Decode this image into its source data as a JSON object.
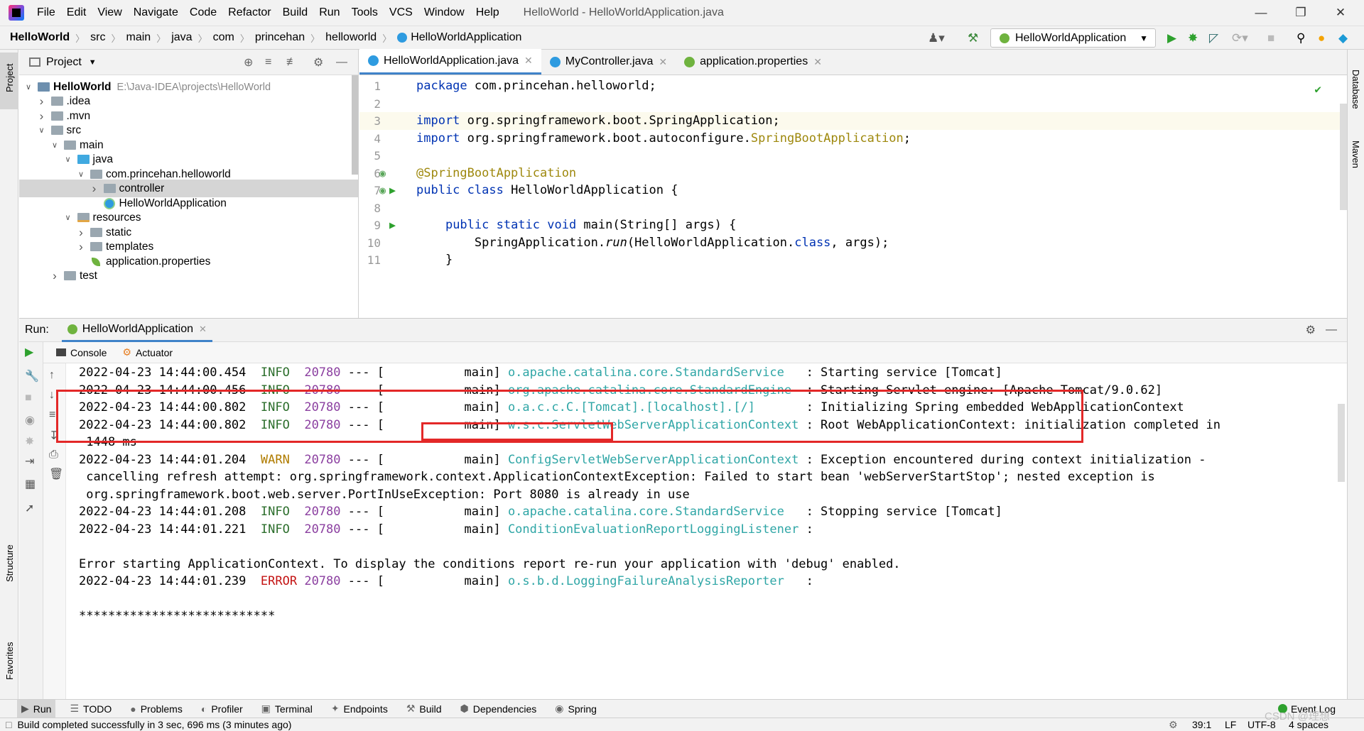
{
  "menu": [
    "File",
    "Edit",
    "View",
    "Navigate",
    "Code",
    "Refactor",
    "Build",
    "Run",
    "Tools",
    "VCS",
    "Window",
    "Help"
  ],
  "window_title": "HelloWorld - HelloWorldApplication.java",
  "breadcrumb": [
    "HelloWorld",
    "src",
    "main",
    "java",
    "com",
    "princehan",
    "helloworld",
    "HelloWorldApplication"
  ],
  "run_config": "HelloWorldApplication",
  "left_tabs": {
    "project": "Project",
    "structure": "Structure",
    "favorites": "Favorites"
  },
  "right_tabs": {
    "database": "Database",
    "maven": "Maven"
  },
  "project_panel": {
    "title": "Project",
    "tree": [
      {
        "label": "HelloWorld",
        "path": "E:\\Java-IDEA\\projects\\HelloWorld",
        "level": 0,
        "open": true,
        "kind": "module"
      },
      {
        "label": ".idea",
        "level": 1,
        "open": false,
        "kind": "folder"
      },
      {
        "label": ".mvn",
        "level": 1,
        "open": false,
        "kind": "folder"
      },
      {
        "label": "src",
        "level": 1,
        "open": true,
        "kind": "folder"
      },
      {
        "label": "main",
        "level": 2,
        "open": true,
        "kind": "folder"
      },
      {
        "label": "java",
        "level": 3,
        "open": true,
        "kind": "source"
      },
      {
        "label": "com.princehan.helloworld",
        "level": 4,
        "open": true,
        "kind": "package"
      },
      {
        "label": "controller",
        "level": 5,
        "open": false,
        "kind": "package",
        "selected": true
      },
      {
        "label": "HelloWorldApplication",
        "level": 5,
        "kind": "class"
      },
      {
        "label": "resources",
        "level": 3,
        "open": true,
        "kind": "resources"
      },
      {
        "label": "static",
        "level": 4,
        "kind": "folder"
      },
      {
        "label": "templates",
        "level": 4,
        "kind": "folder"
      },
      {
        "label": "application.properties",
        "level": 4,
        "kind": "properties"
      },
      {
        "label": "test",
        "level": 2,
        "open": false,
        "kind": "folder"
      }
    ]
  },
  "editor_tabs": [
    {
      "label": "HelloWorldApplication.java",
      "active": true
    },
    {
      "label": "MyController.java",
      "active": false
    },
    {
      "label": "application.properties",
      "active": false
    }
  ],
  "code_lines": [
    {
      "n": "1",
      "html": "<span class=\"kw\">package</span> com.princehan.helloworld;"
    },
    {
      "n": "2",
      "html": ""
    },
    {
      "n": "3",
      "html": "<span class=\"kw\">import</span> org.springframework.boot.SpringApplication;"
    },
    {
      "n": "4",
      "html": "<span class=\"kw\">import</span> org.springframework.boot.autoconfigure.<span class=\"ann\">SpringBootApplication</span>;"
    },
    {
      "n": "5",
      "html": ""
    },
    {
      "n": "6",
      "html": "<span class=\"ann\">@SpringBootApplication</span>"
    },
    {
      "n": "7",
      "html": "<span class=\"kw\">public class</span> HelloWorldApplication {"
    },
    {
      "n": "8",
      "html": ""
    },
    {
      "n": "9",
      "html": "    <span class=\"kw\">public static void</span> main(String[] args) {"
    },
    {
      "n": "10",
      "html": "        SpringApplication.<span class=\"ital\">run</span>(HelloWorldApplication.<span class=\"kw\">class</span>, args);"
    },
    {
      "n": "11",
      "html": "    }"
    }
  ],
  "run_panel": {
    "label": "Run:",
    "tab": "HelloWorldApplication",
    "console_tab": "Console",
    "actuator_tab": "Actuator"
  },
  "log_lines": [
    {
      "date": "2022-04-23 14:44:00.454",
      "level": "INFO",
      "pid": "20780",
      "sep": " --- [",
      "thread": "           main] ",
      "logger": "o.apache.catalina.core.StandardService  ",
      "msg": " : Starting service [Tomcat]"
    },
    {
      "date": "2022-04-23 14:44:00.456",
      "level": "INFO",
      "pid": "20780",
      "sep": " --- [",
      "thread": "           main] ",
      "logger": "org.apache.catalina.core.StandardEngine ",
      "msg": " : Starting Servlet engine: [Apache Tomcat/9.0.62]"
    },
    {
      "date": "2022-04-23 14:44:00.802",
      "level": "INFO",
      "pid": "20780",
      "sep": " --- [",
      "thread": "           main] ",
      "logger": "o.a.c.c.C.[Tomcat].[localhost].[/]      ",
      "msg": " : Initializing Spring embedded WebApplicationContext"
    },
    {
      "date": "2022-04-23 14:44:00.802",
      "level": "INFO",
      "pid": "20780",
      "sep": " --- [",
      "thread": "           main] ",
      "logger": "w.s.c.ServletWebServerApplicationContext",
      "msg": " : Root WebApplicationContext: initialization completed in"
    },
    {
      "cont": " 1448 ms"
    },
    {
      "date": "2022-04-23 14:44:01.204",
      "level": "WARN",
      "pid": "20780",
      "sep": " --- [",
      "thread": "           main] ",
      "logger": "ConfigServletWebServerApplicationContext",
      "msg": " : Exception encountered during context initialization -"
    },
    {
      "cont": " cancelling refresh attempt: org.springframework.context.ApplicationContextException: Failed to start bean 'webServerStartStop'; nested exception is"
    },
    {
      "cont": " org.springframework.boot.web.server.PortInUseException: Port 8080 is already in use"
    },
    {
      "date": "2022-04-23 14:44:01.208",
      "level": "INFO",
      "pid": "20780",
      "sep": " --- [",
      "thread": "           main] ",
      "logger": "o.apache.catalina.core.StandardService  ",
      "msg": " : Stopping service [Tomcat]"
    },
    {
      "date": "2022-04-23 14:44:01.221",
      "level": "INFO",
      "pid": "20780",
      "sep": " --- [",
      "thread": "           main] ",
      "logger": "ConditionEvaluationReportLoggingListener",
      "msg": " :"
    },
    {
      "cont": ""
    },
    {
      "plain": "Error starting ApplicationContext. To display the conditions report re-run your application with 'debug' enabled."
    },
    {
      "date": "2022-04-23 14:44:01.239",
      "level": "ERROR",
      "pid": "20780",
      "sep": " --- [",
      "thread": "           main] ",
      "logger": "o.s.b.d.LoggingFailureAnalysisReporter  ",
      "msg": " :"
    },
    {
      "cont": ""
    },
    {
      "plain": "***************************"
    }
  ],
  "bottom_tabs": [
    "Run",
    "TODO",
    "Problems",
    "Profiler",
    "Terminal",
    "Endpoints",
    "Build",
    "Dependencies",
    "Spring"
  ],
  "event_log": "Event Log",
  "status": {
    "message": "Build completed successfully in 3 sec, 696 ms (3 minutes ago)",
    "position": "39:1",
    "line_sep": "LF",
    "encoding": "UTF-8",
    "indent": "4 spaces"
  },
  "watermark": "CSDN @理想",
  "colors": {
    "accent": "#4083c9",
    "highlight_box": "#e32828",
    "run_green": "#2ea12e"
  }
}
